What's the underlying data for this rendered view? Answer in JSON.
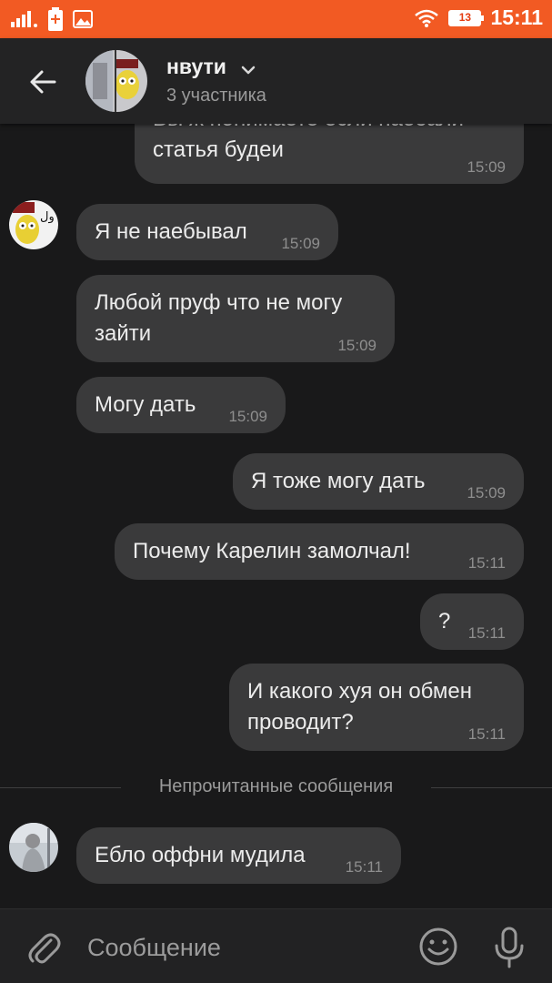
{
  "status_bar": {
    "time": "15:11",
    "battery": "13"
  },
  "header": {
    "title": "нвути",
    "subtitle": "3 участника"
  },
  "messages": [
    {
      "dir": "out",
      "text": "Вы ж понимаете если наебали\nстатья будеи",
      "time": "15:09"
    },
    {
      "dir": "in",
      "text": "Я не наебывал",
      "time": "15:09"
    },
    {
      "dir": "in",
      "text": "Любой пруф что не могу\nзайти",
      "time": "15:09"
    },
    {
      "dir": "in",
      "text": "Могу дать",
      "time": "15:09"
    },
    {
      "dir": "out",
      "text": "Я тоже могу дать",
      "time": "15:09"
    },
    {
      "dir": "out",
      "text": "Почему Карелин замолчал!",
      "time": "15:11"
    },
    {
      "dir": "out",
      "text": "?",
      "time": "15:11"
    },
    {
      "dir": "out",
      "text": "И какого хуя он обмен\nпроводит?",
      "time": "15:11"
    },
    {
      "dir": "in",
      "text": "Еблo оффни мудила",
      "time": "15:11"
    }
  ],
  "unread_divider": "Непрочитанные сообщения",
  "composer": {
    "placeholder": "Сообщение"
  },
  "icons": {
    "back": "arrow-left-icon",
    "attach": "paperclip-icon",
    "emoji": "smiley-icon",
    "mic": "microphone-icon"
  },
  "colors": {
    "status_bar": "#f25a23",
    "background": "#19191a",
    "bubble": "#3a3a3b",
    "header": "#232324"
  }
}
